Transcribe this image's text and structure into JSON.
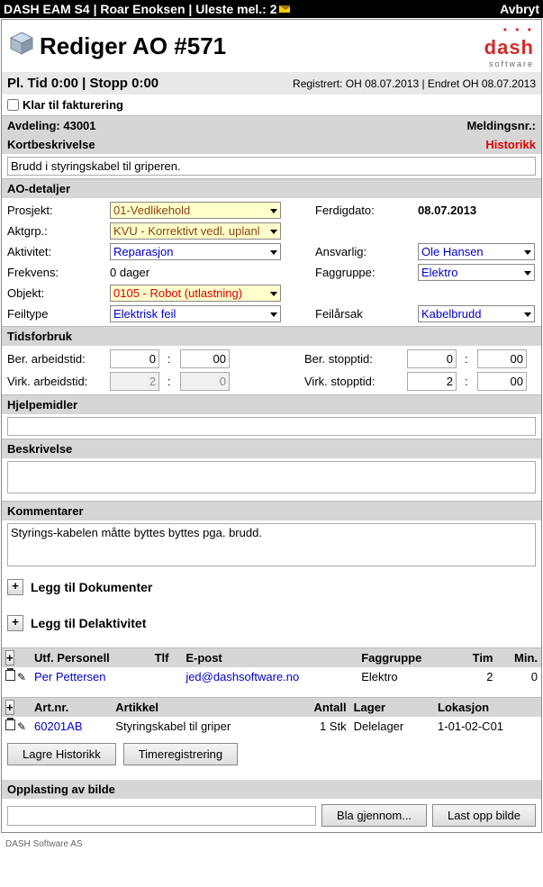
{
  "topbar": {
    "text": "DASH EAM S4 | Roar Enoksen | Uleste mel.: 2",
    "cancel": "Avbryt"
  },
  "header": {
    "title": "Rediger AO #571",
    "logo": "dash",
    "logosub": "software"
  },
  "reg": {
    "plan": "Pl. Tid 0:00 | Stopp 0:00",
    "info": "Registrert: OH 08.07.2013 | Endret OH 08.07.2013"
  },
  "check": {
    "label": "Klar til fakturering"
  },
  "avd": {
    "label": "Avdeling: 43001",
    "meld": "Meldingsnr.:"
  },
  "kort": {
    "label": "Kortbeskrivelse",
    "hist": "Historikk",
    "value": "Brudd i styringskabel til griperen."
  },
  "ao": {
    "title": "AO-detaljer",
    "prosjekt_l": "Prosjekt:",
    "prosjekt": "01-Vedlikehold",
    "ferdig_l": "Ferdigdato:",
    "ferdig": "08.07.2013",
    "aktgrp_l": "Aktgrp.:",
    "aktgrp": "KVU - Korrektivt vedl. uplanl",
    "aktivitet_l": "Aktivitet:",
    "aktivitet": "Reparasjon",
    "ansvarlig_l": "Ansvarlig:",
    "ansvarlig": "Ole Hansen",
    "frekvens_l": "Frekvens:",
    "frekvens": "0 dager",
    "faggruppe_l": "Faggruppe:",
    "faggruppe": "Elektro",
    "objekt_l": "Objekt:",
    "objekt": "0105 - Robot (utlastning)",
    "feiltype_l": "Feiltype",
    "feiltype": "Elektrisk feil",
    "feilarsak_l": "Feilårsak",
    "feilarsak": "Kabelbrudd"
  },
  "tid": {
    "title": "Tidsforbruk",
    "ber_arb_l": "Ber. arbeidstid:",
    "ber_arb_h": "0",
    "ber_arb_m": "00",
    "ber_stp_l": "Ber. stopptid:",
    "ber_stp_h": "0",
    "ber_stp_m": "00",
    "virk_arb_l": "Virk. arbeidstid:",
    "virk_arb_h": "2",
    "virk_arb_m": "0",
    "virk_stp_l": "Virk. stopptid:",
    "virk_stp_h": "2",
    "virk_stp_m": "00"
  },
  "hjelp": {
    "title": "Hjelpemidler",
    "value": ""
  },
  "besk": {
    "title": "Beskrivelse",
    "value": ""
  },
  "komm": {
    "title": "Kommentarer",
    "value": "Styrings-kabelen måtte byttes byttes pga. brudd."
  },
  "dok": {
    "title": "Legg til Dokumenter"
  },
  "del": {
    "title": "Legg til Delaktivitet"
  },
  "pers": {
    "h1": "Utf. Personell",
    "h2": "Tlf",
    "h3": "E-post",
    "h4": "Faggruppe",
    "h5": "Tim",
    "h6": "Min.",
    "name": "Per Pettersen",
    "mail": "jed@dashsoftware.no",
    "grp": "Elektro",
    "tim": "2",
    "min": "0"
  },
  "art": {
    "h1": "Art.nr.",
    "h2": "Artikkel",
    "h3": "Antall",
    "h4": "Lager",
    "h5": "Lokasjon",
    "nr": "60201AB",
    "navn": "Styringskabel til griper",
    "ant": "1 Stk",
    "lager": "Delelager",
    "lok": "1-01-02-C01"
  },
  "btns": {
    "lagre": "Lagre Historikk",
    "time": "Timeregistrering"
  },
  "upl": {
    "title": "Opplasting av bilde",
    "browse": "Bla gjennom...",
    "upload": "Last opp bilde"
  },
  "footer": "DASH Software AS"
}
